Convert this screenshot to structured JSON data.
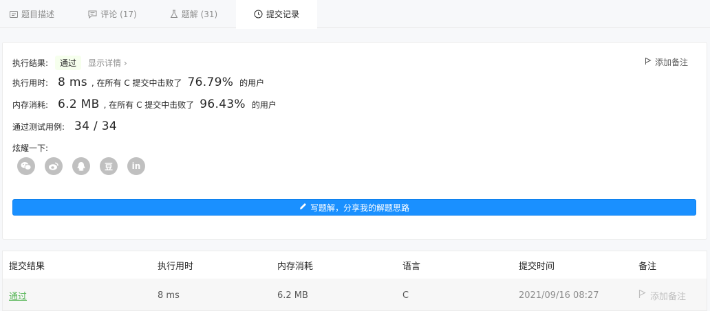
{
  "tabs": [
    {
      "label": "题目描述",
      "icon": "description-icon"
    },
    {
      "label": "评论 (17)",
      "icon": "comment-icon"
    },
    {
      "label": "题解 (31)",
      "icon": "flask-icon"
    },
    {
      "label": "提交记录",
      "icon": "clock-icon"
    }
  ],
  "result": {
    "label_result": "执行结果:",
    "status": "通过",
    "detail_link": "显示详情 ›",
    "add_note": "添加备注",
    "label_time": "执行用时:",
    "time_value": "8 ms",
    "time_beat_prefix": ", 在所有 C 提交中击败了",
    "time_beat_pct": "76.79%",
    "time_suffix": "的用户",
    "label_memory": "内存消耗:",
    "memory_value": "6.2 MB",
    "memory_beat_prefix": ", 在所有 C 提交中击败了",
    "memory_beat_pct": "96.43%",
    "memory_suffix": "的用户",
    "label_tests": "通过测试用例:",
    "tests_value": "34 / 34",
    "label_share": "炫耀一下:",
    "share_icons": [
      "wechat-icon",
      "weibo-icon",
      "qq-icon",
      "douban-icon",
      "linkedin-icon"
    ],
    "douban_glyph": "豆",
    "linkedin_glyph": "in",
    "write_button": "写题解，分享我的解题思路"
  },
  "table": {
    "headers": [
      "提交结果",
      "执行用时",
      "内存消耗",
      "语言",
      "提交时间",
      "备注"
    ],
    "rows": [
      {
        "status": "通过",
        "time": "8 ms",
        "memory": "6.2 MB",
        "language": "C",
        "submitted_at": "2021/09/16 08:27",
        "note": "添加备注"
      }
    ]
  },
  "colors": {
    "accent": "#1a90ff",
    "success": "#5cb85c"
  }
}
